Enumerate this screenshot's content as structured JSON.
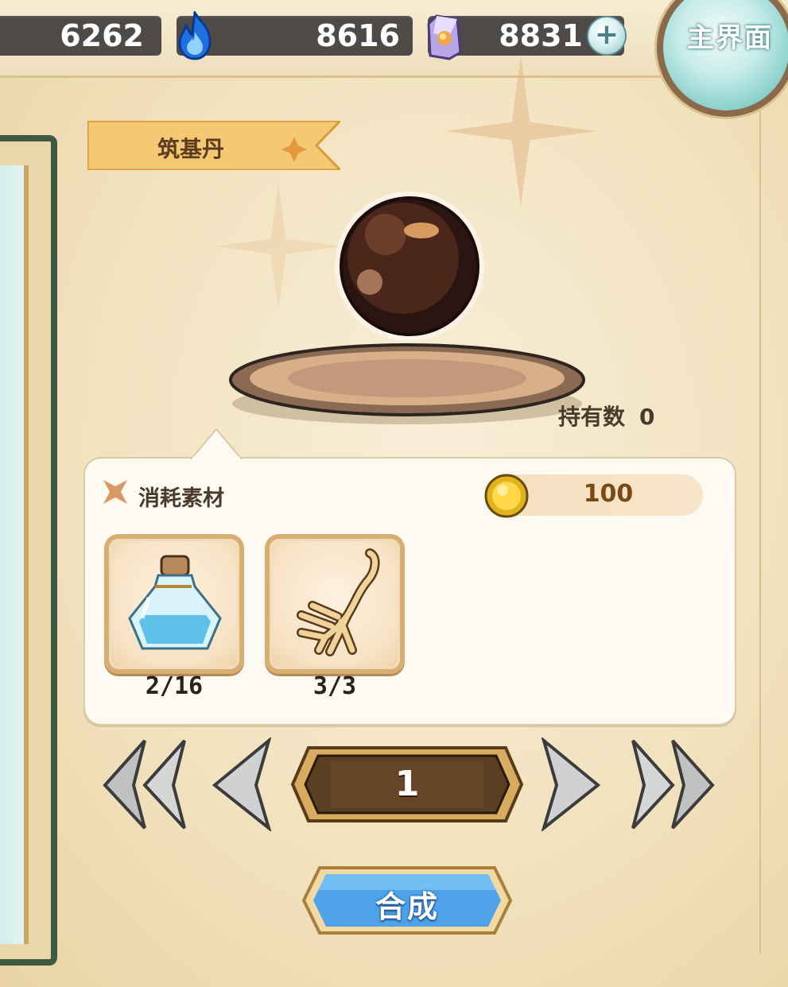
{
  "resources": {
    "first_value": "6262",
    "spirit_fire_value": "8616",
    "crystal_value": "8831",
    "plus_label": "+"
  },
  "main_menu": {
    "label": "主界面"
  },
  "item": {
    "name": "筑基丹",
    "owned_label": "持有数",
    "owned_count": "0"
  },
  "materials": {
    "title": "消耗素材",
    "coin_cost": "100",
    "slots": [
      {
        "icon": "potion-bottle-icon",
        "count": "2/16"
      },
      {
        "icon": "ginseng-root-icon",
        "count": "3/3"
      }
    ]
  },
  "quantity": {
    "value": "1"
  },
  "synthesize": {
    "label": "合成"
  },
  "colors": {
    "resource_bar": "#4d4a48",
    "ribbon": "#f5c873",
    "panel": "#fdfaf2",
    "synth_button": "#4ea3e8",
    "book_cover": "#3f5a43"
  }
}
